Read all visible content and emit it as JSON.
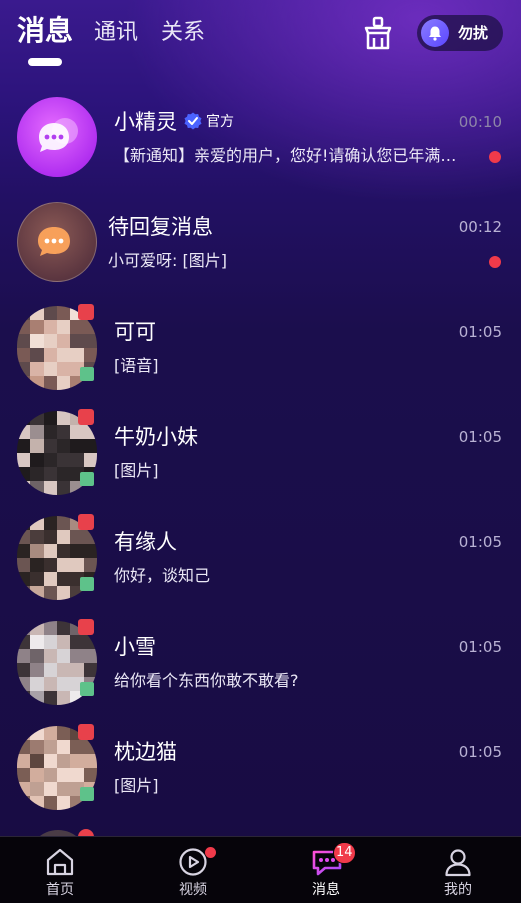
{
  "header": {
    "tabs": [
      {
        "label": "消息",
        "active": true
      },
      {
        "label": "通讯",
        "active": false
      },
      {
        "label": "关系",
        "active": false
      }
    ],
    "clean_icon": "broom-icon",
    "dnd": {
      "label": "勿扰",
      "icon": "bell-icon"
    }
  },
  "messages": [
    {
      "name": "小精灵",
      "verified": true,
      "official_label": "官方",
      "time": "00:10",
      "preview": "【新通知】亲爱的用户，您好!请确认您已年满…",
      "unread": true,
      "avatar": "chat-bubble-icon",
      "avatar_color": "#c33df5"
    },
    {
      "name": "待回复消息",
      "time": "00:12",
      "preview": "小可爱呀: [图片]",
      "unread": true,
      "avatar": "chat-bubble-icon",
      "avatar_color": "#6a4048"
    },
    {
      "name": "可可",
      "time": "01:05",
      "preview": "[语音]",
      "unread": false
    },
    {
      "name": "牛奶小妹",
      "time": "01:05",
      "preview": "[图片]",
      "unread": false
    },
    {
      "name": "有缘人",
      "time": "01:05",
      "preview": "你好，谈知己",
      "unread": false
    },
    {
      "name": "小雪",
      "time": "01:05",
      "preview": "给你看个东西你敢不敢看?",
      "unread": false
    },
    {
      "name": "枕边猫",
      "time": "01:05",
      "preview": "[图片]",
      "unread": false
    }
  ],
  "bottom_nav": [
    {
      "label": "首页",
      "icon": "home-icon",
      "active": false
    },
    {
      "label": "视频",
      "icon": "play-icon",
      "active": false,
      "dot": true
    },
    {
      "label": "消息",
      "icon": "message-icon",
      "active": true,
      "badge": "14"
    },
    {
      "label": "我的",
      "icon": "profile-icon",
      "active": false
    }
  ],
  "colors": {
    "accent_purple": "#b43cf2",
    "unread_red": "#f03a4a",
    "background_top": "#3a1a8e",
    "background_bottom": "#180c42"
  }
}
